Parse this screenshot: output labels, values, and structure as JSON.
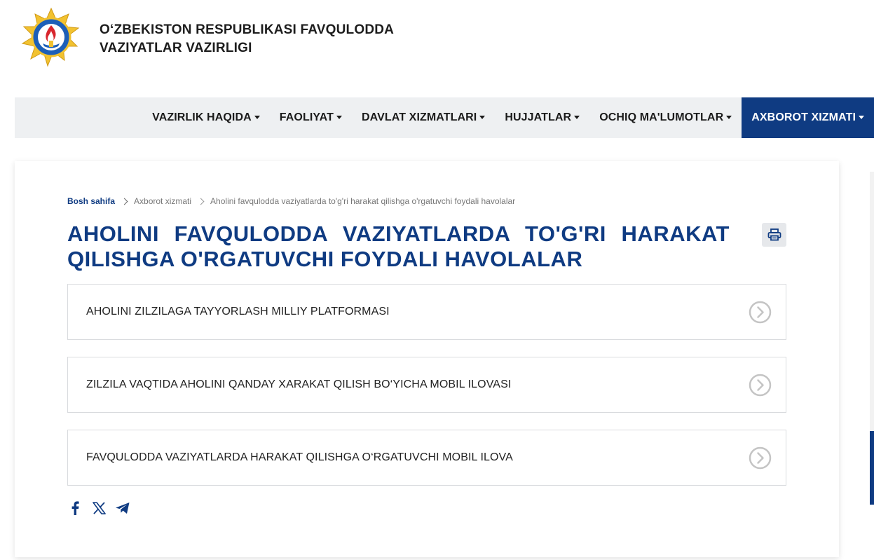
{
  "header": {
    "org_name": "O‘ZBEKISTON RESPUBLIKASI FAVQULODDA VAZIYATLAR VAZIRLIGI",
    "logo_icon": "ministry-emblem-icon"
  },
  "nav": {
    "items": [
      {
        "label": "VAZIRLIK HAQIDA"
      },
      {
        "label": "FAOLIYAT"
      },
      {
        "label": "DAVLAT XIZMATLARI"
      },
      {
        "label": "HUJJATLAR"
      },
      {
        "label": "OCHIQ MA'LUMOTLAR"
      },
      {
        "label": "AXBOROT XIZMATI",
        "active": true
      }
    ]
  },
  "breadcrumb": {
    "home": "Bosh sahifa",
    "section": "Axborot xizmati",
    "current": "Aholini favqulodda vaziyatlarda to'g'ri harakat qilishga o'rgatuvchi foydali havolalar"
  },
  "page": {
    "title": "AHOLINI FAVQULODDA VAZIYATLARDA TO'G'RI HARAKAT QILISHGA O'RGATUVCHI FOYDALI HAVOLALAR",
    "print_icon": "printer-icon"
  },
  "links": [
    {
      "label": "AHOLINI ZILZILAGA TAYYORLASH MILLIY PLATFORMASI"
    },
    {
      "label": "ZILZILA VAQTIDA AHOLINI QANDAY XARAKAT QILISH BO‘YICHA MOBIL ILOVASI"
    },
    {
      "label": "FAVQULODDA VAZIYATLARDA HARAKAT QILISHGA O‘RGATUVCHI MOBIL ILOVA"
    }
  ],
  "share": {
    "icons": [
      "facebook-icon",
      "x-twitter-icon",
      "telegram-icon"
    ]
  },
  "colors": {
    "brand_blue": "#0f3b82",
    "nav_bg": "#eef0f2",
    "border": "#d9dbde"
  }
}
